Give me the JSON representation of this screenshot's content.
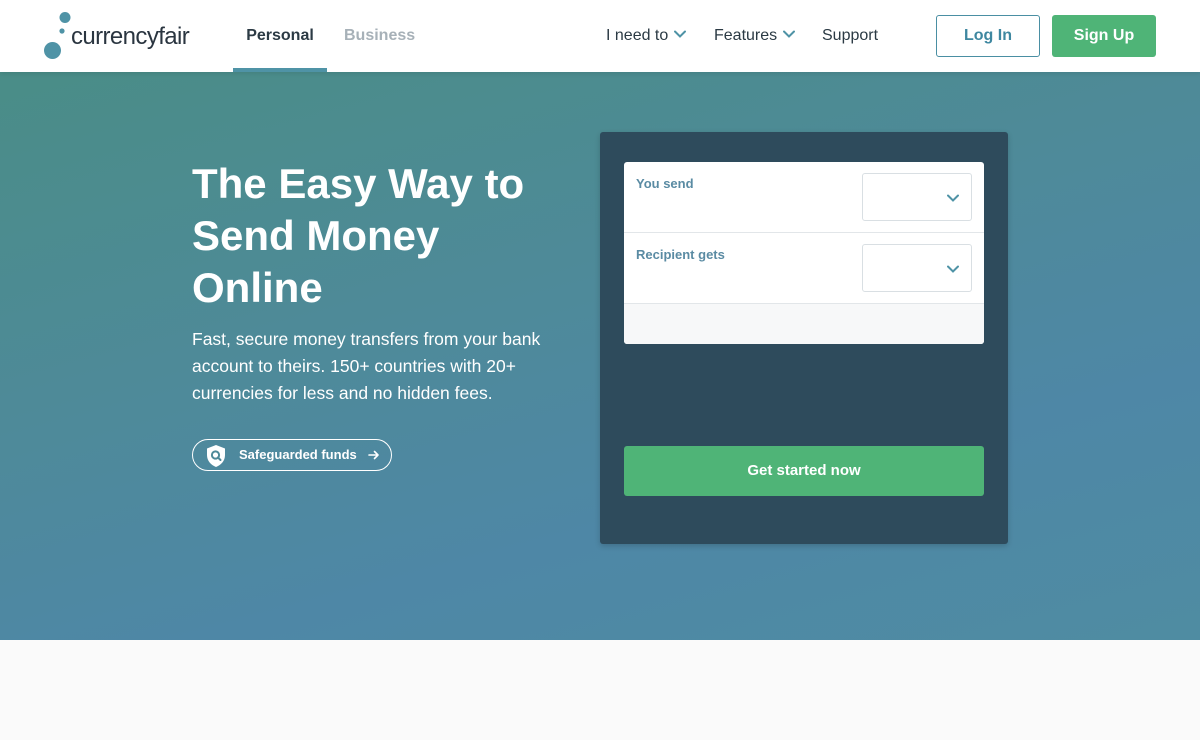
{
  "brand": {
    "name": "currencyfair",
    "logo_color": "#4f93a6"
  },
  "header": {
    "segments": {
      "personal": "Personal",
      "business": "Business",
      "active": "Personal"
    },
    "nav": {
      "need_to": "I need to",
      "features": "Features",
      "support": "Support"
    },
    "login_label": "Log In",
    "signup_label": "Sign Up"
  },
  "hero": {
    "title": "The Easy Way to Send Money Online",
    "subtitle": "Fast, secure money transfers from your bank account to theirs. 150+ countries with 20+ currencies for less and no hidden fees.",
    "safeguard_label": "Safeguarded funds"
  },
  "converter": {
    "send_label": "You send",
    "recipient_label": "Recipient gets",
    "send_currency": "",
    "recipient_currency": "",
    "cta_label": "Get started now"
  },
  "colors": {
    "accent_green": "#4fb477",
    "accent_teal": "#4f93a6",
    "card_bg": "#2e4b5c"
  },
  "icons": [
    "chevron-down-icon",
    "shield-search-icon",
    "arrow-right-icon"
  ]
}
